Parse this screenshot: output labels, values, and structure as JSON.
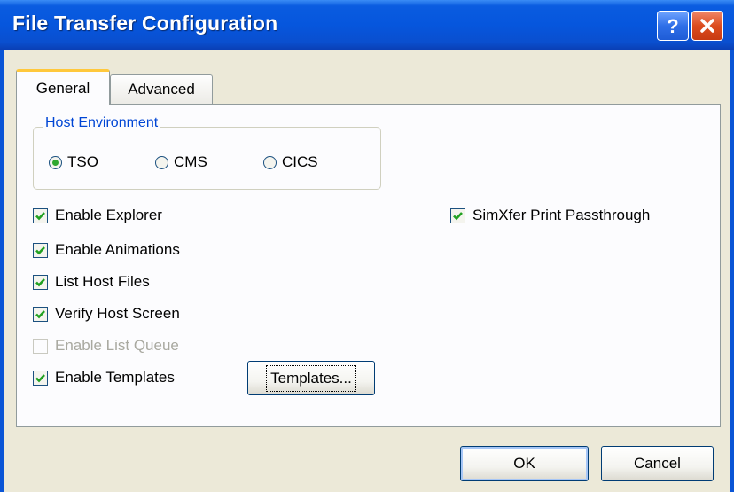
{
  "window": {
    "title": "File Transfer Configuration",
    "help_icon": "help-icon",
    "close_icon": "close-icon"
  },
  "tabs": [
    {
      "label": "General",
      "selected": true
    },
    {
      "label": "Advanced",
      "selected": false
    }
  ],
  "host_environment": {
    "label": "Host Environment",
    "options": [
      {
        "label": "TSO",
        "selected": true
      },
      {
        "label": "CMS",
        "selected": false
      },
      {
        "label": "CICS",
        "selected": false
      }
    ]
  },
  "checkboxes": {
    "enable_explorer": {
      "label": "Enable Explorer",
      "checked": true,
      "enabled": true
    },
    "enable_animations": {
      "label": "Enable Animations",
      "checked": true,
      "enabled": true
    },
    "list_host_files": {
      "label": "List Host Files",
      "checked": true,
      "enabled": true
    },
    "verify_host_screen": {
      "label": "Verify Host Screen",
      "checked": true,
      "enabled": true
    },
    "enable_list_queue": {
      "label": "Enable List Queue",
      "checked": false,
      "enabled": false
    },
    "enable_templates": {
      "label": "Enable Templates",
      "checked": true,
      "enabled": true
    },
    "simxfer_print_passthrough": {
      "label": "SimXfer Print Passthrough",
      "checked": true,
      "enabled": true
    }
  },
  "buttons": {
    "templates": "Templates...",
    "ok": "OK",
    "cancel": "Cancel"
  },
  "colors": {
    "titlebar": "#0a55d6",
    "dialog_bg": "#ece9d8",
    "group_label": "#0046d5",
    "check_mark": "#21a121",
    "tab_highlight": "#ffc83c"
  }
}
